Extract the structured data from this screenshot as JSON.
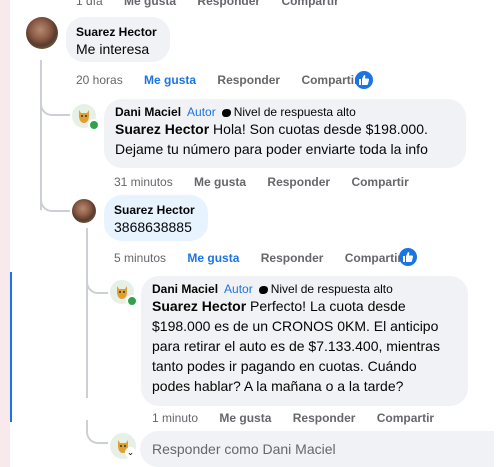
{
  "top_meta": {
    "time": "1 día",
    "like": "Me gusta",
    "reply": "Responder",
    "share": "Compartir"
  },
  "comments": [
    {
      "author": "Suarez Hector",
      "text": "Me interesa",
      "time": "20 horas",
      "like": "Me gusta",
      "reply": "Responder",
      "share": "Compartir",
      "liked": true,
      "reaction_icon": "thumbs-up-icon"
    },
    {
      "author": "Dani Maciel",
      "author_badge": "Autor",
      "level_badge": "Nivel de respuesta alto",
      "mention": "Suarez Hector",
      "text": "Hola! Son cuotas desde $198.000. Dejame tu número para poder enviarte toda la info",
      "time": "31 minutos",
      "like": "Me gusta",
      "reply": "Responder",
      "share": "Compartir",
      "liked": false
    },
    {
      "author": "Suarez Hector",
      "text": "3868638885",
      "time": "5 minutos",
      "like": "Me gusta",
      "reply": "Responder",
      "share": "Compartir",
      "liked": true,
      "reaction_icon": "thumbs-up-icon"
    },
    {
      "author": "Dani Maciel",
      "author_badge": "Autor",
      "level_badge": "Nivel de respuesta alto",
      "mention": "Suarez Hector",
      "text": "Perfecto! La cuota desde $198.000 es de un CRONOS 0KM. El anticipo para retirar el auto es de $7.133.400, mientras tanto podes ir pagando en cuotas. Cuándo podes hablar? A la mañana o a la tarde?",
      "time": "1 minuto",
      "like": "Me gusta",
      "reply": "Responder",
      "share": "Compartir",
      "liked": false
    }
  ],
  "reply_box": {
    "placeholder": "Responder como Dani Maciel"
  },
  "colors": {
    "accent": "#1b74e4",
    "bubble": "#f0f2f5",
    "online": "#31a24c",
    "meta": "#65676b"
  }
}
